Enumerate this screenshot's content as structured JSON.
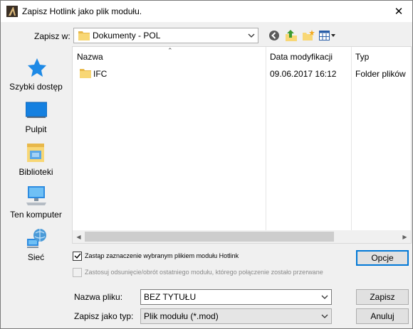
{
  "window": {
    "title": "Zapisz Hotlink jako plik modułu.",
    "close_glyph": "✕"
  },
  "savein": {
    "label": "Zapisz w:",
    "value": "Dokumenty - POL"
  },
  "toolbar": {
    "icons": [
      "back-icon",
      "up-folder-icon",
      "new-folder-icon",
      "view-menu-icon"
    ]
  },
  "places": [
    {
      "label": "Szybki dostęp",
      "icon": "star-icon"
    },
    {
      "label": "Pulpit",
      "icon": "desktop-icon"
    },
    {
      "label": "Biblioteki",
      "icon": "libraries-icon"
    },
    {
      "label": "Ten komputer",
      "icon": "computer-icon"
    },
    {
      "label": "Sieć",
      "icon": "network-icon"
    }
  ],
  "filelist": {
    "columns": [
      "Nazwa",
      "Data modyfikacji",
      "Typ"
    ],
    "rows": [
      {
        "name": "IFC",
        "date": "09.06.2017 16:12",
        "type": "Folder plików"
      }
    ]
  },
  "options": {
    "replace_label": "Zastąp zaznaczenie wybranym plikiem modułu Hotlink",
    "replace_checked": true,
    "apply_label": "Zastosuj odsunięcie/obrót ostatniego modułu, którego połączenie zostało przerwane",
    "apply_checked": false
  },
  "buttons": {
    "options": "Opcje",
    "save": "Zapisz",
    "cancel": "Anuluj"
  },
  "filename": {
    "label": "Nazwa pliku:",
    "value": "BEZ TYTUŁU"
  },
  "filetype": {
    "label": "Zapisz jako typ:",
    "value": "Plik modułu (*.mod)"
  },
  "colors": {
    "accent": "#0078d7",
    "folder": "#f8d775"
  }
}
